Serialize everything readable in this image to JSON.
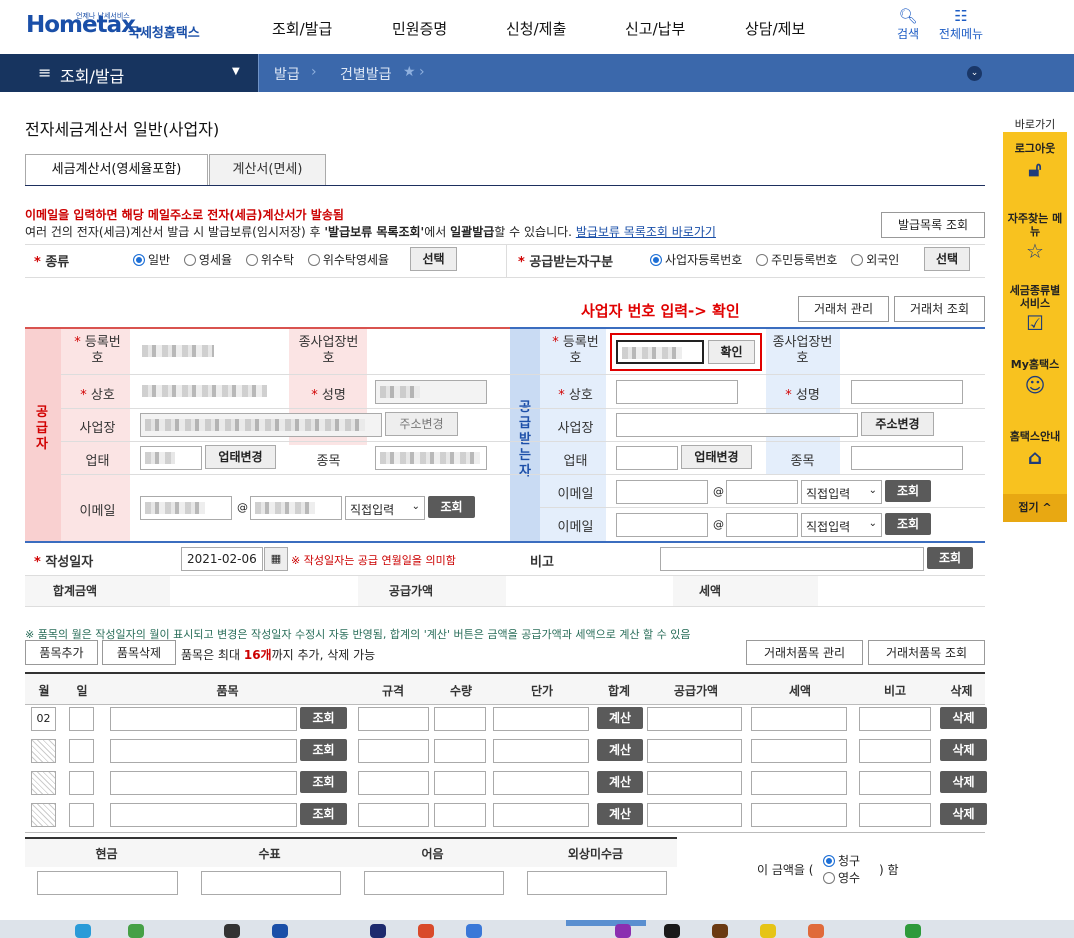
{
  "header": {
    "logo_text": "Hometax.",
    "logo_korean": "국세청홈택스",
    "logo_small": "언제나 납세서비스",
    "menus": [
      "조회/발급",
      "민원증명",
      "신청/제출",
      "신고/납부",
      "상담/제보"
    ],
    "search_label": "검색",
    "allmenu_label": "전체메뉴"
  },
  "nav": {
    "current": "조회/발급",
    "crumbs": [
      "발급",
      "건별발급"
    ]
  },
  "page": {
    "title": "전자세금계산서 일반(사업자)",
    "tabs": [
      "세금계산서(영세율포함)",
      "계산서(면세)"
    ],
    "notice_red": "이메일을 입력하면 해당 메일주소로 전자(세금)계산서가 발송됨",
    "notice_a": "여러 건의 전자(세금)계산서 발급 시 발급보류(임시저장) 후 ",
    "notice_b": "'발급보류 목록조회'",
    "notice_c": "에서 ",
    "notice_d": "일괄발급",
    "notice_e": "할 수 있습니다.",
    "notice_link": "발급보류 목록조회 바로가기",
    "list_button": "발급목록 조회"
  },
  "kind": {
    "label": "종류",
    "options": [
      "일반",
      "영세율",
      "위수탁",
      "위수탁영세율"
    ],
    "selected": "일반",
    "select_button": "선택",
    "recv_label": "공급받는자구분",
    "recv_options": [
      "사업자등록번호",
      "주민등록번호",
      "외국인"
    ],
    "recv_selected": "사업자등록번호",
    "recv_select_button": "선택"
  },
  "annotation": "사업자 번호 입력-> 확인",
  "partner_buttons": [
    "거래처 관리",
    "거래처 조회"
  ],
  "supplier": {
    "side_label": "공급자",
    "reg_label": "등록번호",
    "sub_label": "종사업장번호",
    "name_label": "상호",
    "ceo_label": "성명",
    "addr_label": "사업장",
    "addr_button": "주소변경",
    "biz_label": "업태",
    "biz_button": "업태변경",
    "item_label": "종목",
    "email_label": "이메일",
    "email_at": "@",
    "email_domain": "직접입력",
    "email_button": "조회"
  },
  "receiver": {
    "side_label": "공급받는자",
    "reg_label": "등록번호",
    "confirm_button": "확인",
    "sub_label": "종사업장번호",
    "name_label": "상호",
    "ceo_label": "성명",
    "addr_label": "사업장",
    "addr_button": "주소변경",
    "biz_label": "업태",
    "biz_button": "업태변경",
    "item_label": "종목",
    "email_label": "이메일",
    "email_at": "@",
    "email_domain": "직접입력",
    "email_button": "조회"
  },
  "date": {
    "label": "작성일자",
    "value": "2021-02-06",
    "note": "※ 작성일자는 공급 연월일을 의미함",
    "memo_label": "비고",
    "memo_button": "조회"
  },
  "sums": {
    "total_label": "합계금액",
    "supply_label": "공급가액",
    "tax_label": "세액"
  },
  "items": {
    "notice": "※ 품목의 월은 작성일자의 월이 표시되고 변경은 작성일자 수정시 자동 반영됨, 합계의 '계산' 버튼은 금액을 공급가액과 세액으로 계산 할 수 있음",
    "add_button": "품목추가",
    "del_button": "품목삭제",
    "limit_a": "품목은 최대 ",
    "limit_b": "16개",
    "limit_c": "까지 추가, 삭제 가능",
    "manage_button": "거래처품목 관리",
    "query_button": "거래처품목 조회",
    "headers": [
      "월",
      "일",
      "품목",
      "규격",
      "수량",
      "단가",
      "합계",
      "공급가액",
      "세액",
      "비고",
      "삭제"
    ],
    "first_month": "02",
    "row_query": "조회",
    "row_calc": "계산",
    "row_delete": "삭제"
  },
  "payment": {
    "headers": [
      "현금",
      "수표",
      "어음",
      "외상미수금"
    ],
    "sentence_a": "이 금액을 (",
    "opt1": "청구",
    "opt2": "영수",
    "sentence_b": ") 함"
  },
  "quickmenu": {
    "title": "바로가기",
    "items": [
      "로그아웃",
      "자주찾는 메뉴",
      "세금종류별 서비스",
      "My홈택스",
      "홈택스안내"
    ],
    "fold": "접기 ^"
  }
}
